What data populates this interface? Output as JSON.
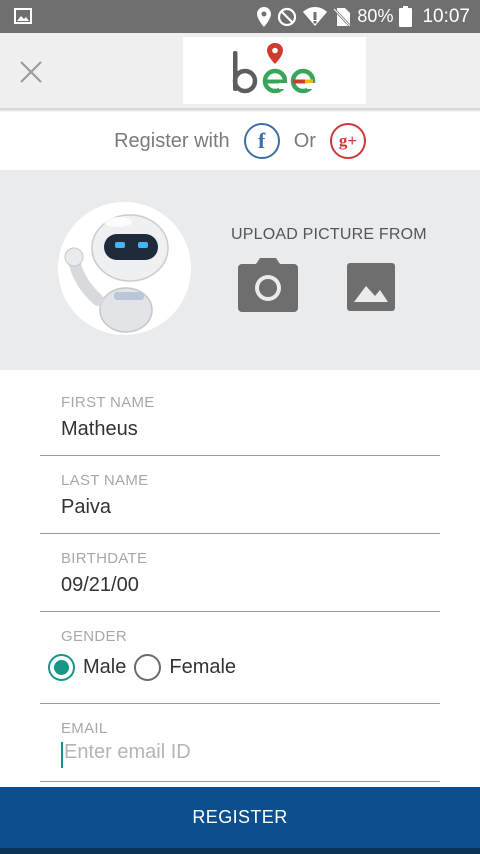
{
  "status_bar": {
    "battery_percent": "80%",
    "time": "10:07",
    "icons": [
      "gallery-icon",
      "location-icon",
      "do-not-disturb-icon",
      "wifi-icon",
      "no-sim-icon",
      "battery-icon"
    ]
  },
  "header": {
    "close_icon": "close-icon",
    "logo_text": "bee"
  },
  "social": {
    "register_with": "Register with",
    "facebook_letter": "f",
    "or": "Or",
    "google_letter": "g+"
  },
  "picture": {
    "upload_label": "UPLOAD PICTURE FROM",
    "camera_icon": "camera-icon",
    "gallery_icon": "image-icon"
  },
  "form": {
    "first_name": {
      "label": "FIRST NAME",
      "value": "Matheus"
    },
    "last_name": {
      "label": "LAST NAME",
      "value": "Paiva"
    },
    "birthdate": {
      "label": "BIRTHDATE",
      "value": "09/21/00"
    },
    "gender": {
      "label": "GENDER",
      "options": [
        {
          "label": "Male",
          "checked": true
        },
        {
          "label": "Female",
          "checked": false
        }
      ]
    },
    "email": {
      "label": "EMAIL",
      "value": "",
      "placeholder": "Enter email ID"
    }
  },
  "register_button": "REGISTER",
  "colors": {
    "accent_teal": "#159688",
    "register_blue": "#0b4f8e",
    "facebook_blue": "#3f6ea8",
    "google_red": "#cc3b3b",
    "status_bar_gray": "#6f6f6f"
  }
}
